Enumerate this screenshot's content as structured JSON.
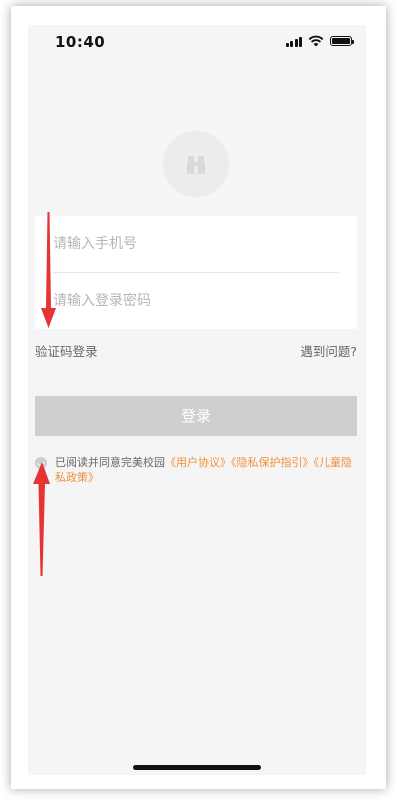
{
  "status_bar": {
    "time": "10:40",
    "icons": [
      "signal-icon",
      "wifi-icon",
      "battery-icon"
    ]
  },
  "login_form": {
    "phone_placeholder": "请输入手机号",
    "password_placeholder": "请输入登录密码",
    "sms_login_link": "验证码登录",
    "help_link": "遇到问题?",
    "login_button": "登录"
  },
  "agreement": {
    "checked": true,
    "prefix": "已阅读并同意完美校园",
    "user_agreement": "《用户协议》",
    "privacy_guide": "《隐私保护指引》",
    "child_privacy": "《儿童隐私政策》"
  },
  "annotations": {
    "arrow_color": "#e63333"
  },
  "colors": {
    "background": "#f5f5f5",
    "link_accent": "#f0913a",
    "button_disabled": "#cfcfcf"
  }
}
